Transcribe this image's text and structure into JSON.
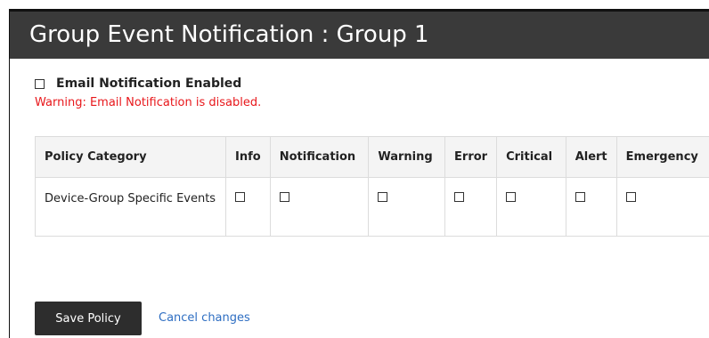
{
  "header": {
    "title": "Group Event Notification : Group 1"
  },
  "email": {
    "label": "Email Notification Enabled",
    "checked": false
  },
  "warning": {
    "text": "Warning: Email Notification is disabled.",
    "color": "#e8171b"
  },
  "table": {
    "columns": [
      "Policy Category",
      "Info",
      "Notification",
      "Warning",
      "Error",
      "Critical",
      "Alert",
      "Emergency"
    ],
    "rows": [
      {
        "category": "Device-Group Specific Events",
        "checks": [
          false,
          false,
          false,
          false,
          false,
          false,
          false
        ]
      }
    ]
  },
  "actions": {
    "save_label": "Save Policy",
    "cancel_label": "Cancel changes"
  },
  "colors": {
    "header_bg": "#3a3a3a",
    "button_bg": "#2d2d2d",
    "link": "#2e6ec2"
  }
}
